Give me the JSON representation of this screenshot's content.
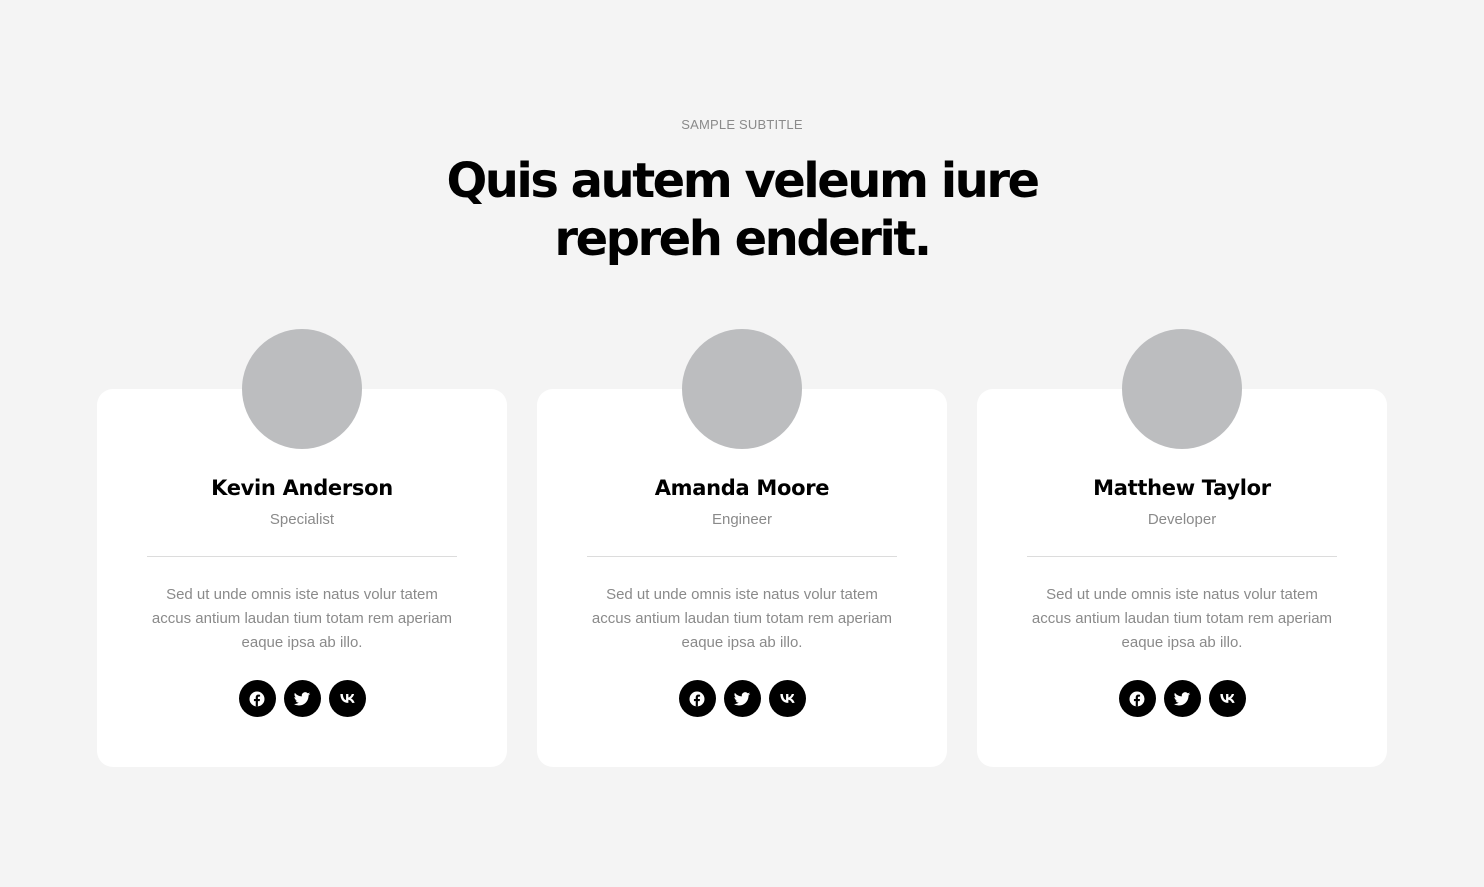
{
  "section": {
    "subtitle": "SAMPLE SUBTITLE",
    "title_line1": "Quis autem veleum iure",
    "title_line2": "repreh enderit."
  },
  "team": [
    {
      "name": "Kevin Anderson",
      "role": "Specialist",
      "description": "Sed ut unde omnis iste natus volur tatem accus antium laudan tium totam rem aperiam eaque ipsa ab illo."
    },
    {
      "name": "Amanda Moore",
      "role": "Engineer",
      "description": "Sed ut unde omnis iste natus volur tatem accus antium laudan tium totam rem aperiam eaque ipsa ab illo."
    },
    {
      "name": "Matthew Taylor",
      "role": "Developer",
      "description": "Sed ut unde omnis iste natus volur tatem accus antium laudan tium totam rem aperiam eaque ipsa ab illo."
    }
  ],
  "social_icons": [
    "facebook-icon",
    "twitter-icon",
    "vk-icon"
  ],
  "colors": {
    "background": "#f4f4f4",
    "card": "#ffffff",
    "avatar_placeholder": "#bcbdbf",
    "muted_text": "#8a8a8a",
    "heading": "#000000",
    "social_button": "#000000"
  }
}
